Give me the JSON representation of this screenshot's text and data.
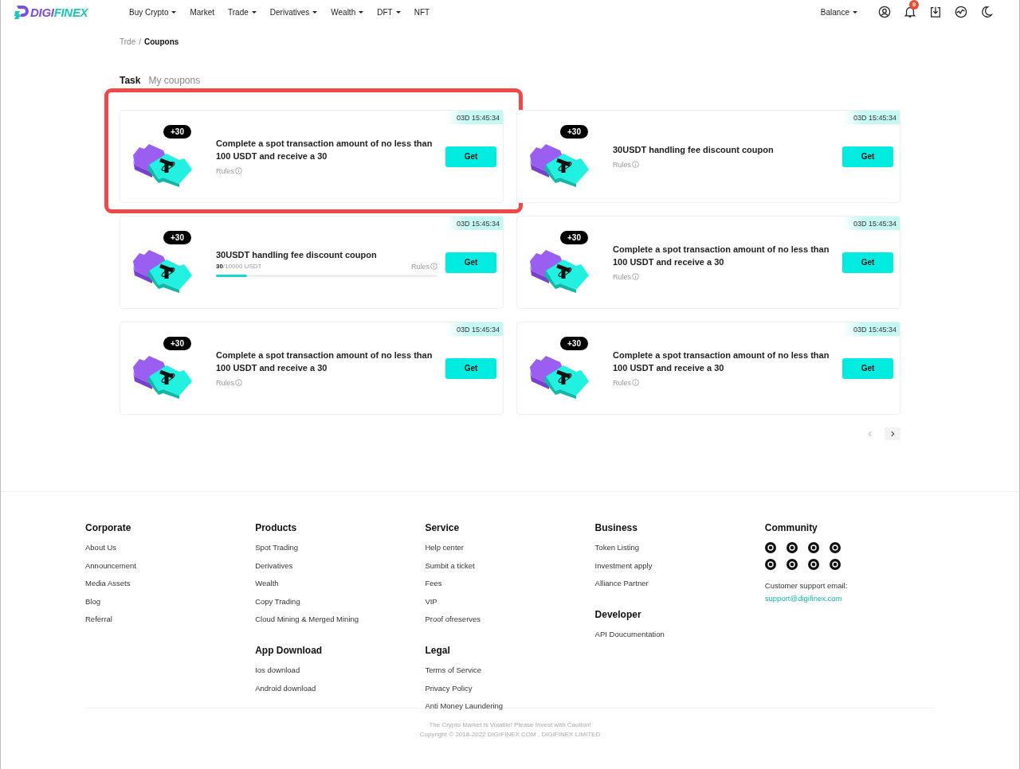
{
  "logo": [
    "DIGI",
    "FINEX"
  ],
  "nav": [
    {
      "label": "Buy Crypto",
      "dropdown": true
    },
    {
      "label": "Market",
      "dropdown": false
    },
    {
      "label": "Trade",
      "dropdown": true
    },
    {
      "label": "Derivatives",
      "dropdown": true
    },
    {
      "label": "Wealth",
      "dropdown": true
    },
    {
      "label": "DFT",
      "dropdown": true
    },
    {
      "label": "NFT",
      "dropdown": false
    }
  ],
  "balance": {
    "label": "Balance",
    "dropdown": true
  },
  "notifications": "9",
  "breadcrumb": [
    "Trde",
    "/",
    "Coupons"
  ],
  "tabs": [
    {
      "label": "Task",
      "selected": true
    },
    {
      "label": "My coupons",
      "selected": false
    }
  ],
  "tasks": [
    {
      "kind": "rules",
      "highlighted": true,
      "timer": "03D 15:45:34",
      "reward": "+30",
      "title": "Complete a spot transaction amount of no less than 100 USDT and receive a 30",
      "rules": "Rules",
      "button": "Get"
    },
    {
      "kind": "rules",
      "highlighted": false,
      "timer": "03D 15:45:34",
      "reward": "+30",
      "title": "30USDT handling fee discount coupon",
      "rules": "Rules",
      "button": "Get"
    },
    {
      "kind": "progress",
      "highlighted": false,
      "timer": "03D 15:45:34",
      "reward": "+30",
      "title": "30USDT handling fee discount coupon",
      "progress": "**30**/10000 USDT",
      "level": 0.14,
      "rules": "Rules",
      "button": "Get"
    },
    {
      "kind": "rules",
      "highlighted": false,
      "timer": "03D 15:45:34",
      "reward": "+30",
      "title": "Complete a spot transaction amount of no less than 100 USDT and receive a 30",
      "rules": "Rules",
      "button": "Get"
    },
    {
      "kind": "rules",
      "highlighted": false,
      "timer": "03D 15:45:34",
      "reward": "+30",
      "title": "Complete a spot transaction amount of no less than 100 USDT and receive a 30",
      "rules": "Rules",
      "button": "Get"
    },
    {
      "kind": "rules",
      "highlighted": false,
      "timer": "03D 15:45:34",
      "reward": "+30",
      "title": "Complete a spot transaction amount of no less than 100 USDT and receive a 30",
      "rules": "Rules",
      "button": "Get"
    }
  ],
  "pagination": {
    "prev_disabled": true,
    "next_disabled": false
  },
  "footer": {
    "columns": [
      {
        "sections": [
          {
            "heading": "Corporate",
            "links": [
              "About Us",
              "Announcement",
              "Media Assets",
              "Blog",
              "Referral"
            ]
          }
        ]
      },
      {
        "sections": [
          {
            "heading": "Products",
            "links": [
              "Spot Trading",
              "Derivatives",
              "Wealth",
              "Copy Trading",
              "Cloud Mining & Merged Mining"
            ]
          },
          {
            "heading": "App Download",
            "links": [
              "Ios download",
              "Android download"
            ]
          }
        ]
      },
      {
        "sections": [
          {
            "heading": "Service",
            "links": [
              "Help center",
              "Sumbit a ticket",
              "Fees",
              "VIP",
              "Proof ofreserves"
            ]
          },
          {
            "heading": "Legal",
            "links": [
              "Terms of Service",
              "Privacy Policy",
              "Anti Money Laundering"
            ]
          }
        ]
      },
      {
        "sections": [
          {
            "heading": "Business",
            "links": [
              "Token Listing",
              "Investment apply",
              "Alliance Partner"
            ]
          },
          {
            "heading": "Developer",
            "links": [
              "API Doucumentation"
            ]
          }
        ]
      }
    ],
    "community": {
      "heading": "Community",
      "support_label": "Customer support email:",
      "support_email": "support@digifinex.com"
    },
    "disclaimer": "The Crypto Market is Volatile! Please Invest with Caution!",
    "copyright": "Copyright © 2018-2022 DIGIFINEX.COM , DIGIFINEX LIMITED"
  }
}
